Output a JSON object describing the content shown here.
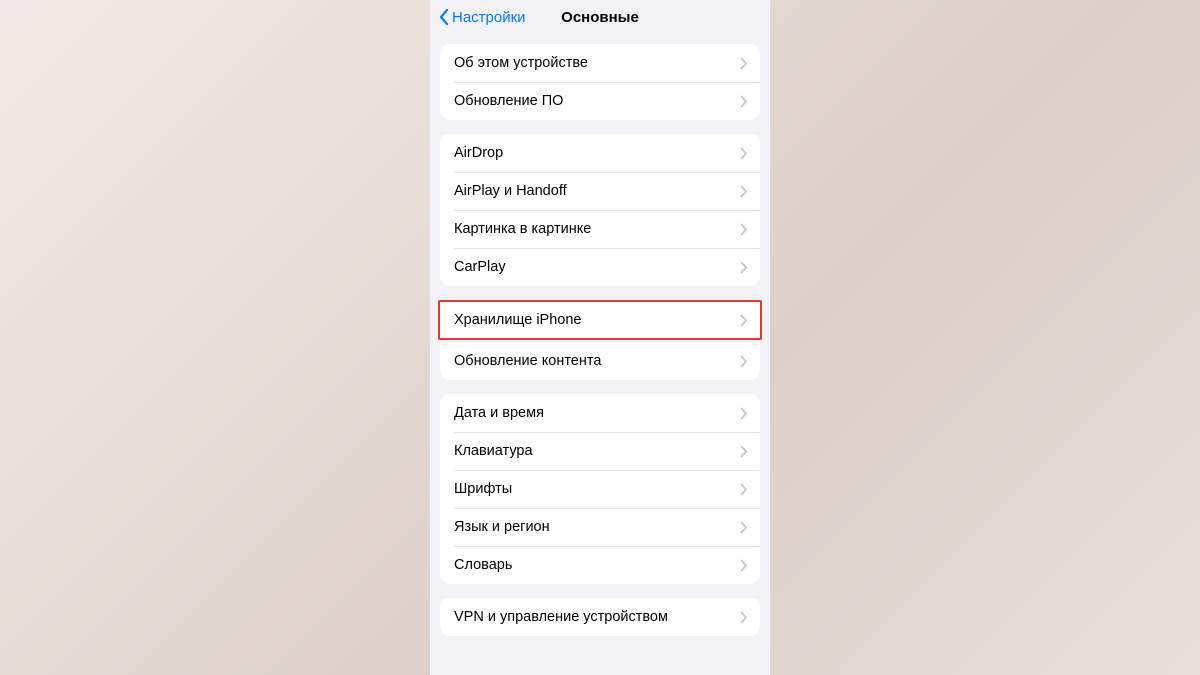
{
  "nav": {
    "back_label": "Настройки",
    "title": "Основные"
  },
  "groups": [
    {
      "items": [
        {
          "label": "Об этом устройстве",
          "name": "about-device"
        },
        {
          "label": "Обновление ПО",
          "name": "software-update"
        }
      ]
    },
    {
      "items": [
        {
          "label": "AirDrop",
          "name": "airdrop"
        },
        {
          "label": "AirPlay и Handoff",
          "name": "airplay-handoff"
        },
        {
          "label": "Картинка в картинке",
          "name": "picture-in-picture"
        },
        {
          "label": "CarPlay",
          "name": "carplay"
        }
      ]
    },
    {
      "highlighted_index": 0,
      "items": [
        {
          "label": "Хранилище iPhone",
          "name": "iphone-storage"
        },
        {
          "label": "Обновление контента",
          "name": "background-app-refresh"
        }
      ]
    },
    {
      "items": [
        {
          "label": "Дата и время",
          "name": "date-time"
        },
        {
          "label": "Клавиатура",
          "name": "keyboard"
        },
        {
          "label": "Шрифты",
          "name": "fonts"
        },
        {
          "label": "Язык и регион",
          "name": "language-region"
        },
        {
          "label": "Словарь",
          "name": "dictionary"
        }
      ]
    },
    {
      "items": [
        {
          "label": "VPN и управление устройством",
          "name": "vpn-device-management"
        }
      ]
    }
  ]
}
